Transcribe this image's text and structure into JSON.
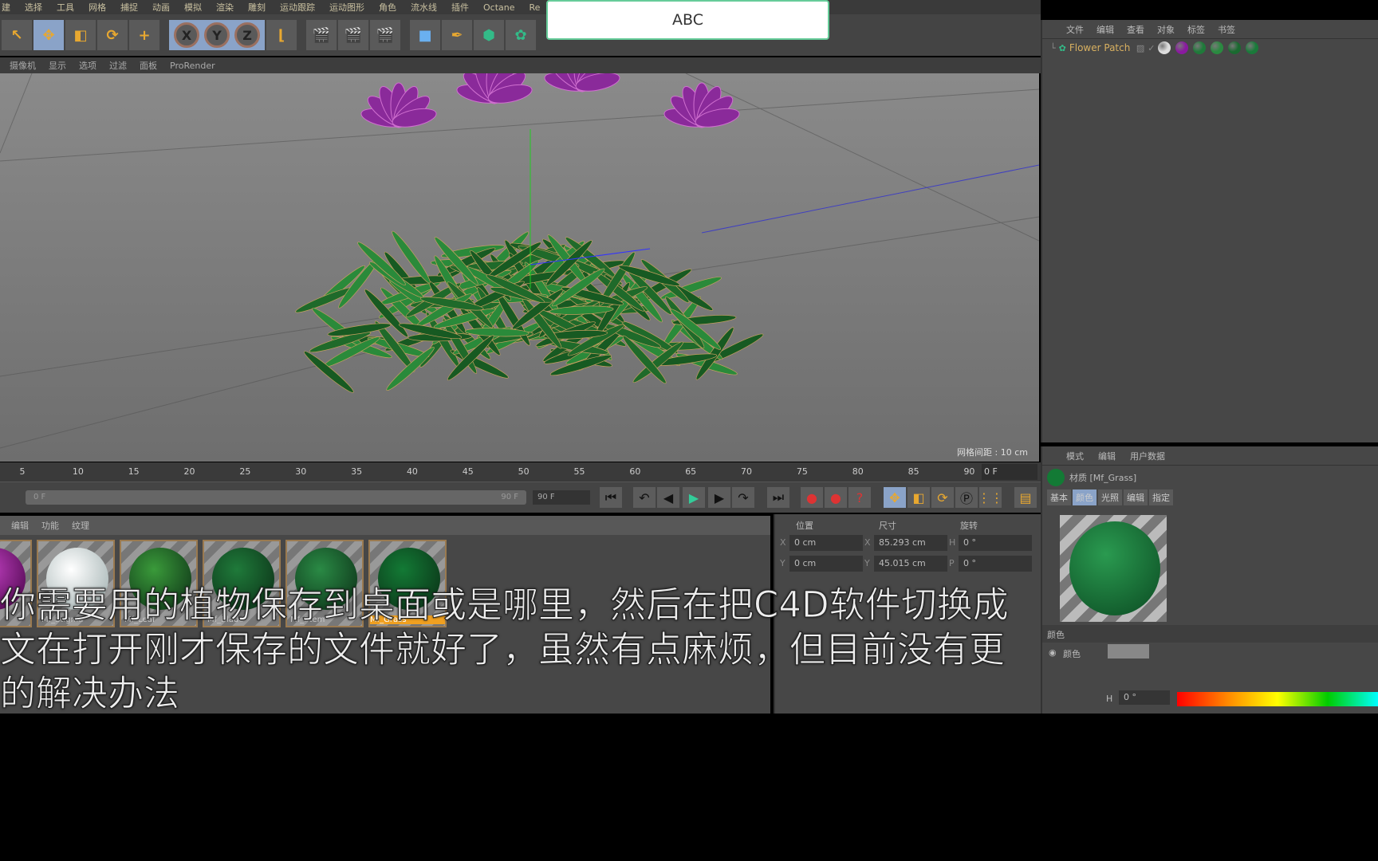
{
  "menubar": [
    "建",
    "选择",
    "工具",
    "网格",
    "捕捉",
    "动画",
    "模拟",
    "渲染",
    "雕刻",
    "运动跟踪",
    "运动图形",
    "角色",
    "流水线",
    "插件",
    "Octane",
    "Re"
  ],
  "toolbar": {
    "x": "X",
    "y": "Y",
    "z": "Z"
  },
  "viewport_menu": [
    "摄像机",
    "显示",
    "选项",
    "过滤",
    "面板",
    "ProRender"
  ],
  "viewport": {
    "grid_label": "网格间距 : 10 cm"
  },
  "timeline": {
    "ticks": [
      "5",
      "10",
      "15",
      "20",
      "25",
      "30",
      "35",
      "40",
      "45",
      "50",
      "55",
      "60",
      "65",
      "70",
      "75",
      "80",
      "85",
      "90"
    ],
    "current_frame": "0 F",
    "slider_start": "0 F",
    "slider_end": "90 F",
    "end_frame": "90 F"
  },
  "material_menu": [
    "编辑",
    "功能",
    "纹理"
  ],
  "materials": [
    {
      "name": "",
      "color": "#9a20a0"
    },
    {
      "name": "Mf_Stigma",
      "color": "#e0e4e8"
    },
    {
      "name": "Mf_Leaf",
      "color": "#3a9a3a"
    },
    {
      "name": "Mf_Blade",
      "color": "#1f7a3a"
    },
    {
      "name": "Mf_Stem",
      "color": "#2a8a45"
    },
    {
      "name": "Mf_Grass",
      "color": "#137a35",
      "selected": true
    }
  ],
  "coords": {
    "headers": [
      "位置",
      "尺寸",
      "旋转"
    ],
    "rows": [
      {
        "l1": "X",
        "pos": "0 cm",
        "l2": "X",
        "size": "85.293 cm",
        "l3": "H",
        "rot": "0 °"
      },
      {
        "l1": "Y",
        "pos": "0 cm",
        "l2": "Y",
        "size": "45.015 cm",
        "l3": "P",
        "rot": "0 °"
      }
    ]
  },
  "object_manager": {
    "menu": [
      "文件",
      "编辑",
      "查看",
      "对象",
      "标签",
      "书签"
    ],
    "object": "Flower Patch"
  },
  "attributes": {
    "menu": [
      "模式",
      "编辑",
      "用户数据"
    ],
    "title": "材质 [Mf_Grass]",
    "tabs": [
      "基本",
      "颜色",
      "光照",
      "编辑",
      "指定"
    ],
    "section": "颜色",
    "color_label": "颜色",
    "h_label": "H",
    "h_value": "0 °"
  },
  "popup": {
    "text": "ABC"
  },
  "subtitles": [
    "你需要用的植物保存到桌面或是哪里，然后在把C4D软件切换成",
    "文在打开刚才保存的文件就好了，虽然有点麻烦，但目前没有更",
    "的解决办法"
  ]
}
